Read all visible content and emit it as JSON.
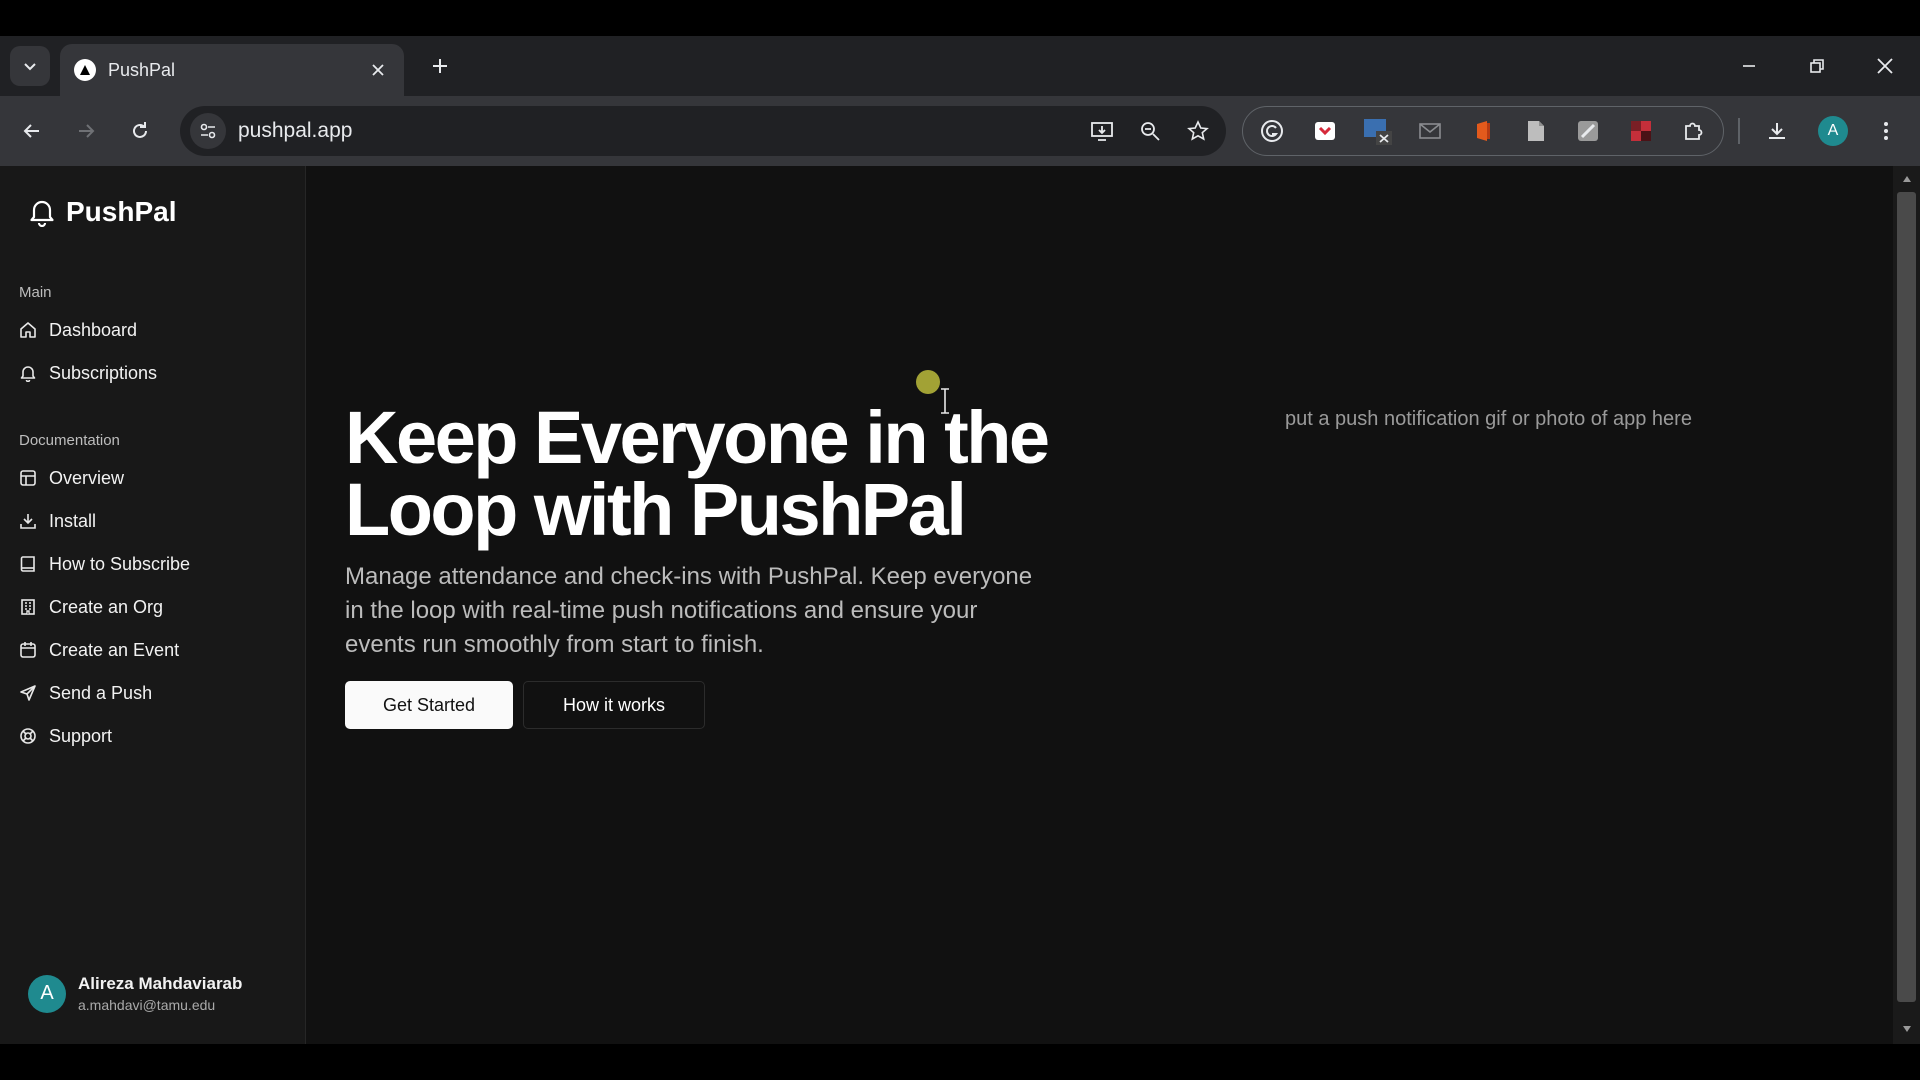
{
  "browser": {
    "tab_title": "PushPal",
    "url": "pushpal.app",
    "profile_initial": "A"
  },
  "sidebar": {
    "brand": "PushPal",
    "sections": [
      {
        "label": "Main",
        "items": [
          {
            "label": "Dashboard",
            "icon": "home-icon"
          },
          {
            "label": "Subscriptions",
            "icon": "bell-icon"
          }
        ]
      },
      {
        "label": "Documentation",
        "items": [
          {
            "label": "Overview",
            "icon": "layout-icon"
          },
          {
            "label": "Install",
            "icon": "download-icon"
          },
          {
            "label": "How to Subscribe",
            "icon": "book-icon"
          },
          {
            "label": "Create an Org",
            "icon": "building-icon"
          },
          {
            "label": "Create an Event",
            "icon": "calendar-icon"
          },
          {
            "label": "Send a Push",
            "icon": "send-icon"
          },
          {
            "label": "Support",
            "icon": "lifebuoy-icon"
          }
        ]
      }
    ],
    "user": {
      "initial": "A",
      "name": "Alireza Mahdaviarab",
      "email": "a.mahdavi@tamu.edu"
    }
  },
  "hero": {
    "title": "Keep Everyone in the Loop with PushPal",
    "subtitle": "Manage attendance and check-ins with PushPal. Keep everyone in the loop with real-time push notifications and ensure your events run smoothly from start to finish.",
    "primary_button": "Get Started",
    "secondary_button": "How it works",
    "media_placeholder": "put a push notification gif or photo of app here"
  },
  "colors": {
    "page_bg": "#111111",
    "sidebar_bg": "#181818",
    "accent_avatar": "#1f8a8f",
    "primary_button_bg": "#fafafa"
  }
}
